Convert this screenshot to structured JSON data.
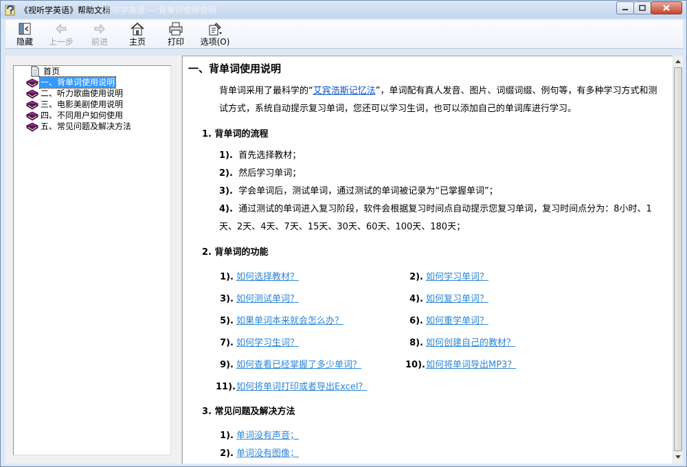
{
  "window": {
    "title": "《视听学英语》帮助文档",
    "title_ghost": "视听学英语 — 背单词使用说明"
  },
  "toolbar": {
    "hide_label": "隐藏",
    "back_label": "上一步",
    "forward_label": "前进",
    "home_label": "主页",
    "print_label": "打印",
    "options_label": "选项(O)"
  },
  "tree": {
    "items": [
      {
        "label": "首页",
        "icon": "page-icon"
      },
      {
        "label": "一、背单词使用说明",
        "icon": "book-icon",
        "selected": true
      },
      {
        "label": "二、听力歌曲使用说明",
        "icon": "book-icon"
      },
      {
        "label": "三、电影美剧使用说明",
        "icon": "book-icon"
      },
      {
        "label": "四、不同用户如何使用",
        "icon": "book-icon"
      },
      {
        "label": "五、常见问题及解决方法",
        "icon": "book-icon"
      }
    ]
  },
  "content": {
    "heading": "一、背单词使用说明",
    "intro_before": "背单词采用了最科学的“",
    "intro_link": "艾宾浩斯记忆法",
    "intro_after": "”，单词配有真人发音、图片、词缀词缀、例句等，有多种学习方式和测试方式，系统自动提示复习单词，您还可以学习生词，也可以添加自己的单词库进行学习。",
    "section1_title": "1. 背单词的流程",
    "steps": [
      {
        "num": "1).",
        "text": "首先选择教材；"
      },
      {
        "num": "2).",
        "text": "然后学习单词；"
      },
      {
        "num": "3).",
        "text": "学会单词后，测试单词，通过测试的单词被记录为“已掌握单词”；"
      },
      {
        "num": "4).",
        "text": "通过测试的单词进入复习阶段，软件会根据复习时间点自动提示您复习单词，复习时间点分为：8小时、1天、2天、4天、7天、15天、30天、60天、100天、180天；"
      }
    ],
    "section2_title": "2. 背单词的功能",
    "features": [
      {
        "num": "1).",
        "text": "如何选择教材？"
      },
      {
        "num": "2).",
        "text": "如何学习单词？"
      },
      {
        "num": "3).",
        "text": "如何测试单词？"
      },
      {
        "num": "4).",
        "text": "如何复习单词？"
      },
      {
        "num": "5).",
        "text": "如果单词本来就会怎么办？"
      },
      {
        "num": "6).",
        "text": "如何重学单词？"
      },
      {
        "num": "7).",
        "text": "如何学习生词？"
      },
      {
        "num": "8).",
        "text": "如何创建自己的教材？"
      },
      {
        "num": "9).",
        "text": "如何查看已经掌握了多少单词？"
      },
      {
        "num": "10).",
        "text": "如何将单词导出MP3？"
      },
      {
        "num": "11).",
        "text": "如何将单词打印或者导出Excel？"
      }
    ],
    "section3_title": "3. 常见问题及解决方法",
    "problems": [
      {
        "num": "1).",
        "text": "单词没有声音；"
      },
      {
        "num": "2).",
        "text": "单词没有图像；"
      }
    ]
  },
  "colors": {
    "link": "#0b55c4",
    "selection": "#3399ff",
    "book": "#7a1f6e"
  }
}
